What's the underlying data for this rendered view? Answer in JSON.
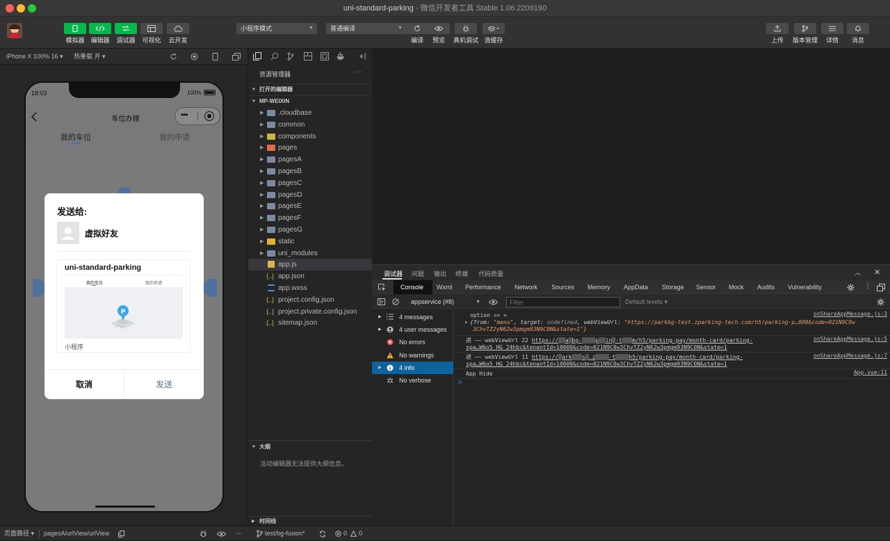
{
  "window": {
    "title": "uni-standard-parking",
    "subtitle": " - 微信开发者工具 Stable 1.06.2209190"
  },
  "toolbar": {
    "left_buttons": [
      "模拟器",
      "编辑器",
      "调试器",
      "可视化",
      "云开发"
    ],
    "mode_select": "小程序模式",
    "compile_select": "普通编译",
    "center_buttons": [
      "编译",
      "预览",
      "真机调试",
      "清缓存"
    ],
    "right_buttons": [
      "上传",
      "版本管理",
      "详情",
      "消息"
    ]
  },
  "simulator": {
    "device": "iPhone X 100% 16",
    "hot_reload": "热重载 开",
    "time": "18:03",
    "battery": "100%",
    "nav_title": "车位办理",
    "tabs": [
      "我的车位",
      "我的申请"
    ]
  },
  "share_modal": {
    "title": "发送给:",
    "friend": "虚拟好友",
    "card_title": "uni-standard-parking",
    "card_tabs": [
      "我的车位",
      "我的申请"
    ],
    "card_footer": "小程序",
    "cancel": "取消",
    "send": "发送"
  },
  "explorer": {
    "title": "资源管理器",
    "open_editors": "打开的编辑器",
    "project": "MP-WEIXIN",
    "items": [
      {
        "name": ".cloudbase",
        "type": "folder",
        "color": "#7a8aa0"
      },
      {
        "name": "common",
        "type": "folder",
        "color": "#7a8aa0"
      },
      {
        "name": "components",
        "type": "folder",
        "color": "#c7b740"
      },
      {
        "name": "pages",
        "type": "folder",
        "color": "#e06c4a"
      },
      {
        "name": "pagesA",
        "type": "folder",
        "color": "#7a8aa0"
      },
      {
        "name": "pagesB",
        "type": "folder",
        "color": "#7a8aa0"
      },
      {
        "name": "pagesC",
        "type": "folder",
        "color": "#7a8aa0"
      },
      {
        "name": "pagesD",
        "type": "folder",
        "color": "#7a8aa0"
      },
      {
        "name": "pagesE",
        "type": "folder",
        "color": "#7a8aa0"
      },
      {
        "name": "pagesF",
        "type": "folder",
        "color": "#7a8aa0"
      },
      {
        "name": "pagesG",
        "type": "folder",
        "color": "#7a8aa0"
      },
      {
        "name": "static",
        "type": "folder",
        "color": "#e0b23a"
      },
      {
        "name": "uni_modules",
        "type": "folder",
        "color": "#7a8aa0"
      },
      {
        "name": "app.js",
        "type": "js",
        "color": "#d9b44a"
      },
      {
        "name": "app.json",
        "type": "json",
        "color": "#d9b44a"
      },
      {
        "name": "app.wxss",
        "type": "css",
        "color": "#4a90d9"
      },
      {
        "name": "project.config.json",
        "type": "json",
        "color": "#d9b44a"
      },
      {
        "name": "project.private.config.json",
        "type": "json",
        "color": "#d9b44a"
      },
      {
        "name": "sitemap.json",
        "type": "json",
        "color": "#d9b44a"
      }
    ],
    "outline": "大纲",
    "outline_empty": "活动编辑器无法提供大纲信息。",
    "timeline": "时间线"
  },
  "devtools": {
    "top_tabs": [
      "调试器",
      "问题",
      "输出",
      "终端",
      "代码质量"
    ],
    "tabs": [
      "Console",
      "Wxml",
      "Performance",
      "Network",
      "Sources",
      "Memory",
      "AppData",
      "Storage",
      "Sensor",
      "Mock",
      "Audits",
      "Vulnerability"
    ],
    "context": "appservice (#8)",
    "filter_placeholder": "Filter",
    "levels": "Default levels",
    "sidebar": [
      {
        "label": "4 messages",
        "icon": "list"
      },
      {
        "label": "4 user messages",
        "icon": "user"
      },
      {
        "label": "No errors",
        "icon": "error"
      },
      {
        "label": "No warnings",
        "icon": "warning"
      },
      {
        "label": "4 info",
        "icon": "info"
      },
      {
        "label": "No verbose",
        "icon": "verbose"
      }
    ],
    "logs": [
      {
        "l1": "option == >",
        "l2a": "{from: ",
        "l2b": "\"menu\"",
        "l2c": ", target: ",
        "l2d": "undefined",
        "l2e": ", webViewUrl: ",
        "l2f": "\"https://parkbg-test.zparking-tech.com/h5/parking-p…000&code=021N9C0w",
        "l3": "3ChvTZ2yN62w3pmgm93N9C0N&state=1\"}",
        "src": "onShareAppMessage.js:3"
      },
      {
        "l1a": "进 —— webViewUrl 22 ",
        "l1b": "https://",
        "l1c": "a",
        "l1d": "bg-",
        "l1e": "p",
        "l1f": "in",
        "l1g": "-t",
        "l1h": "m/h5/parking-pay/month-card/parking-",
        "l2": "spa…W6o5 HG 24hbc&tenantId=10000&code=021N9C0w3ChvTZ2yN62w3pmgm93N9C0N&state=1",
        "src": "onShareAppMessage.js:5"
      },
      {
        "l1a": "进 —— webViewUrl 11 ",
        "l1b": "https://",
        "l1c": "ark",
        "l1d": "s",
        "l1e": ".z",
        "l1f": "-t",
        "l1g": "",
        "l1h": "h5/parking-pay/month-card/parking-",
        "l2": "spa…W6o5 HG 24hbc&tenantId=10000&code=021N9C0w3ChvTZ2yN62w3pmgm93N9C0N&state=1",
        "src": "onShareAppMessage.js:7"
      },
      {
        "l1": "App Hide",
        "src": "App.vue:11"
      }
    ],
    "prompt": ">"
  },
  "bottombar": {
    "path_label": "页面路径",
    "path": "pagesA/urlView/urlView",
    "branch": "test/bg-fusion*",
    "errors": "0",
    "warnings": "0"
  },
  "colors": {
    "accent": "#07b84c",
    "info_selected": "#0e639c",
    "send": "#576b95"
  }
}
